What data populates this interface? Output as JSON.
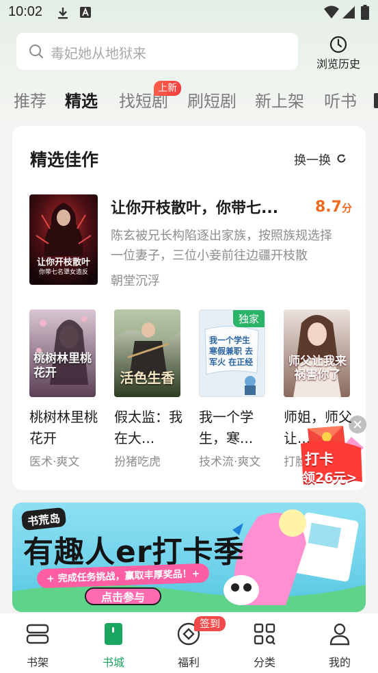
{
  "status_bar": {
    "time": "10:02",
    "icons": [
      "download-icon",
      "font-icon",
      "wifi-icon",
      "signal-icon",
      "battery-icon"
    ]
  },
  "search": {
    "placeholder": "毒妃她从地狱来",
    "history_label": "浏览历史"
  },
  "tabs": {
    "items": [
      "推荐",
      "精选",
      "找短剧",
      "刷短剧",
      "新上架",
      "听书"
    ],
    "active": "精选",
    "badge": "上新"
  },
  "section": {
    "title": "精选佳作",
    "refresh_label": "换一换"
  },
  "featured": {
    "title": "让你开枝散叶，你带七...",
    "score": "8.7",
    "score_unit": "分",
    "description": "陈玄被兄长构陷逐出家族，按照族规选择一位妻子，三位小妾前往边疆开枝散叶。...",
    "author": "朝堂沉浮",
    "cover_text_line1": "让你开枝散叶",
    "cover_text_line2": "你带七名犟女造反"
  },
  "books": [
    {
      "title": "桃树林里桃花开",
      "tag": "医术·爽文",
      "cover_text": "桃树林里桃花开",
      "cover_color": "#7a5a74"
    },
    {
      "title": "假太监：我在大...",
      "tag": "扮猪吃虎",
      "cover_text": "活色生香",
      "cover_color": "#4f5c3a"
    },
    {
      "title": "我一个学生，寒...",
      "tag": "技术流·爽文",
      "cover_text": "我一个学生 寒假兼职 去军火 在正经",
      "cover_color": "#dfe9f2",
      "badge": "独家"
    },
    {
      "title": "师姐，师父让...",
      "tag": "打脸",
      "cover_text": "师父让我来祸害你了",
      "cover_color": "#b58d80"
    }
  ],
  "checkin_float": {
    "line1": "打卡",
    "line2": "领26元>"
  },
  "banner": {
    "brand": "书荒岛",
    "title": "有趣人er打卡季",
    "subtitle": "+ 完成任务挑战，赢取丰厚奖品！+",
    "cta": "点击参与"
  },
  "bottom_nav": {
    "items": [
      {
        "label": "书架",
        "icon": "bookshelf-icon"
      },
      {
        "label": "书城",
        "icon": "bookstore-icon"
      },
      {
        "label": "福利",
        "icon": "welfare-icon"
      },
      {
        "label": "分类",
        "icon": "category-icon"
      },
      {
        "label": "我的",
        "icon": "profile-icon"
      }
    ],
    "active": "书城",
    "welfare_badge": "签到"
  },
  "colors": {
    "accent_green": "#1aa661",
    "score_orange": "#f06a1e",
    "badge_red": "#f24a4a"
  }
}
